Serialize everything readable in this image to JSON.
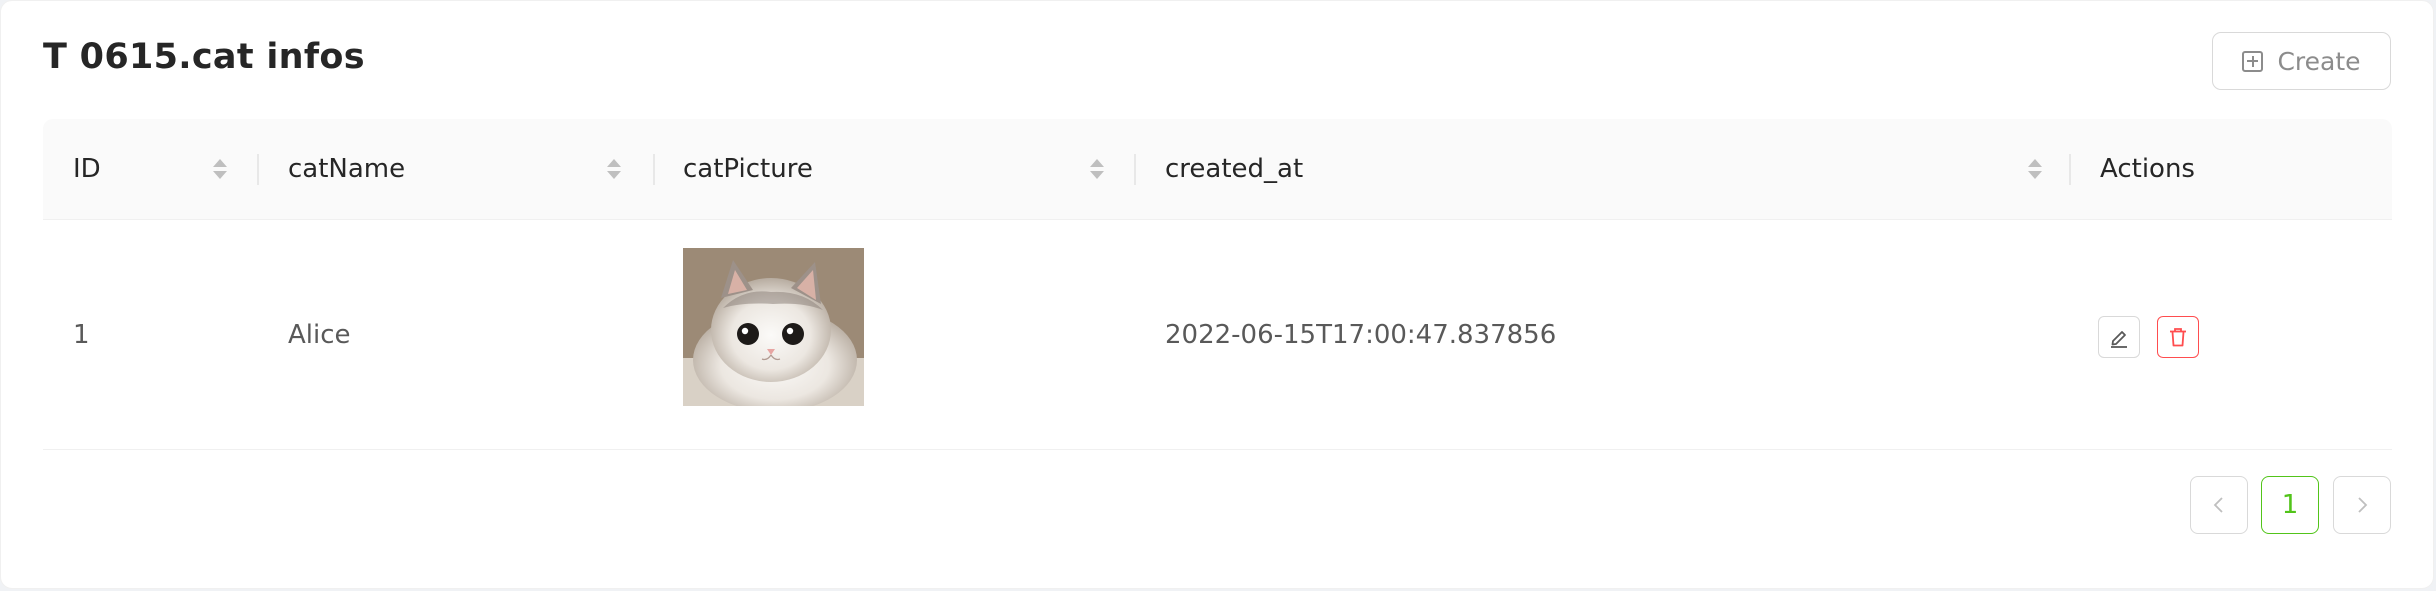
{
  "header": {
    "title": "T 0615.cat infos",
    "create_label": "Create"
  },
  "table": {
    "columns": [
      {
        "label": "ID",
        "sortable": true
      },
      {
        "label": "catName",
        "sortable": true
      },
      {
        "label": "catPicture",
        "sortable": true
      },
      {
        "label": "created_at",
        "sortable": true
      },
      {
        "label": "Actions",
        "sortable": false
      }
    ],
    "rows": [
      {
        "id": "1",
        "catName": "Alice",
        "created_at": "2022-06-15T17:00:47.837856"
      }
    ]
  },
  "pagination": {
    "current_page": "1"
  },
  "icons": {
    "create": "plus-square-icon",
    "sort": "sort-caret-icon",
    "edit": "edit-icon",
    "delete": "delete-icon",
    "prev": "chevron-left-icon",
    "next": "chevron-right-icon"
  },
  "colors": {
    "accent_green": "#52c41a",
    "danger": "#ff4d4f"
  }
}
